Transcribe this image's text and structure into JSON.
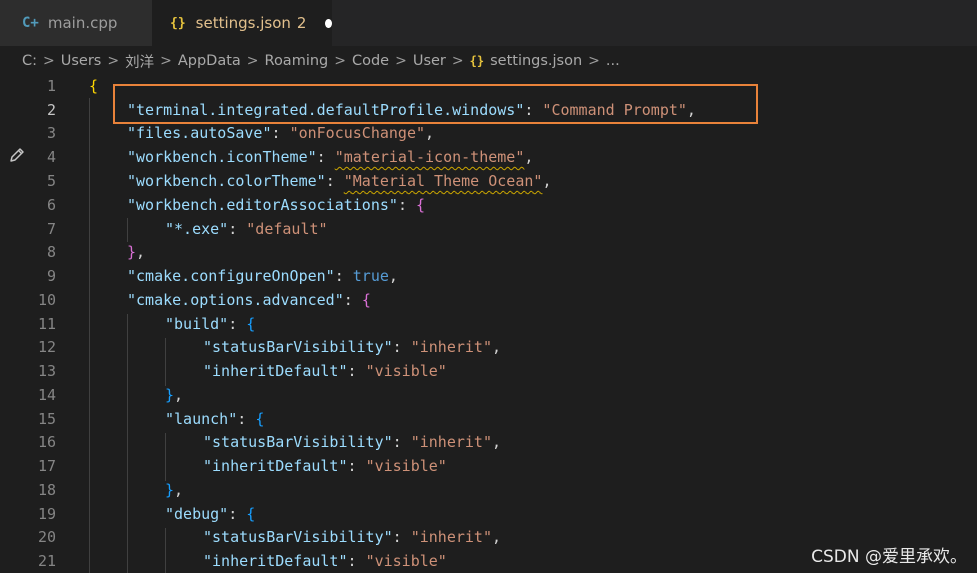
{
  "tabs": [
    {
      "icon": "cpp-icon",
      "icon_glyph": "C+",
      "label": "main.cpp",
      "count": "",
      "active": false
    },
    {
      "icon": "json-braces-icon",
      "icon_glyph": "{}",
      "label": "settings.json",
      "count": "2",
      "active": true,
      "dirty": true
    }
  ],
  "breadcrumb": {
    "segments": [
      "C:",
      "Users",
      "刘洋",
      "AppData",
      "Roaming",
      "Code",
      "User"
    ],
    "file_icon_glyph": "{}",
    "file": "settings.json",
    "ellipsis": "...",
    "separator": ">"
  },
  "editor": {
    "active_line": 2,
    "line_numbers": [
      "1",
      "2",
      "3",
      "4",
      "5",
      "6",
      "7",
      "8",
      "9",
      "10",
      "11",
      "12",
      "13",
      "14",
      "15",
      "16",
      "17",
      "18",
      "19",
      "20",
      "21"
    ],
    "lines": {
      "l1": {
        "t0": "{"
      },
      "l2": {
        "t0": "\"terminal.integrated.defaultProfile.windows\"",
        "t1": ": ",
        "t2": "\"Command Prompt\"",
        "t3": ","
      },
      "l3": {
        "t0": "\"files.autoSave\"",
        "t1": ": ",
        "t2": "\"onFocusChange\"",
        "t3": ","
      },
      "l4": {
        "t0": "\"workbench.iconTheme\"",
        "t1": ": ",
        "t2": "\"material-icon-theme\"",
        "t3": ","
      },
      "l5": {
        "t0": "\"workbench.colorTheme\"",
        "t1": ": ",
        "t2": "\"Material Theme Ocean\"",
        "t3": ","
      },
      "l6": {
        "t0": "\"workbench.editorAssociations\"",
        "t1": ": ",
        "t2": "{"
      },
      "l7": {
        "t0": "\"*.exe\"",
        "t1": ": ",
        "t2": "\"default\""
      },
      "l8": {
        "t0": "}",
        "t1": ","
      },
      "l9": {
        "t0": "\"cmake.configureOnOpen\"",
        "t1": ": ",
        "t2": "true",
        "t3": ","
      },
      "l10": {
        "t0": "\"cmake.options.advanced\"",
        "t1": ": ",
        "t2": "{"
      },
      "l11": {
        "t0": "\"build\"",
        "t1": ": ",
        "t2": "{"
      },
      "l12": {
        "t0": "\"statusBarVisibility\"",
        "t1": ": ",
        "t2": "\"inherit\"",
        "t3": ","
      },
      "l13": {
        "t0": "\"inheritDefault\"",
        "t1": ": ",
        "t2": "\"visible\""
      },
      "l14": {
        "t0": "}",
        "t1": ","
      },
      "l15": {
        "t0": "\"launch\"",
        "t1": ": ",
        "t2": "{"
      },
      "l16": {
        "t0": "\"statusBarVisibility\"",
        "t1": ": ",
        "t2": "\"inherit\"",
        "t3": ","
      },
      "l17": {
        "t0": "\"inheritDefault\"",
        "t1": ": ",
        "t2": "\"visible\""
      },
      "l18": {
        "t0": "}",
        "t1": ","
      },
      "l19": {
        "t0": "\"debug\"",
        "t1": ": ",
        "t2": "{"
      },
      "l20": {
        "t0": "\"statusBarVisibility\"",
        "t1": ": ",
        "t2": "\"inherit\"",
        "t3": ","
      },
      "l21": {
        "t0": "\"inheritDefault\"",
        "t1": ": ",
        "t2": "\"visible\""
      }
    }
  },
  "annotation": {
    "color": "#e8823a"
  },
  "watermark": "CSDN @爱里承欢。",
  "colors": {
    "key": "#9cdcfe",
    "string": "#ce9178",
    "bracket_gold": "#ffd700",
    "bracket_magenta": "#da70d6",
    "bracket_blue": "#179fff",
    "keyword": "#569cd6"
  }
}
